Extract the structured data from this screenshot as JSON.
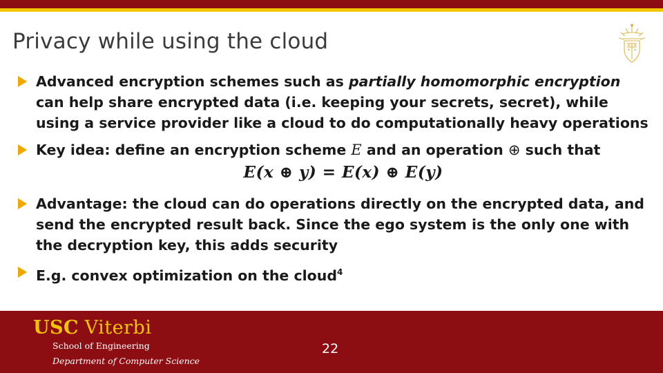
{
  "slide": {
    "title": "Privacy while using the cloud",
    "colors": {
      "maroon": "#8c0d12",
      "gold": "#f2c500",
      "bullet_arrow": "#f0a800",
      "title_text": "#3b3b3b",
      "body_text": "#1a1a1a"
    },
    "bullets": [
      {
        "id": "bullet-1",
        "segments": [
          {
            "text": "Advanced encryption schemes such as ",
            "style": "bold"
          },
          {
            "text": "partially homomorphic encryption",
            "style": "bold-italic"
          },
          {
            "text": " can help share encrypted data (i.e. keeping your secrets, secret), while using a service provider like a cloud to do computationally heavy operations",
            "style": "bold"
          }
        ]
      },
      {
        "id": "bullet-2",
        "segments": [
          {
            "text": "Key idea: define an encryption scheme ",
            "style": "bold"
          },
          {
            "text": "E",
            "style": "math"
          },
          {
            "text": " and an operation ",
            "style": "bold"
          },
          {
            "text": "⊕",
            "style": "math-op"
          },
          {
            "text": " such that",
            "style": "bold"
          }
        ],
        "equation": "E(x ⊕ y) = E(x) ⊕ E(y)"
      },
      {
        "id": "bullet-3",
        "segments": [
          {
            "text": "Advantage: the cloud can do operations directly on the encrypted data, and send the encrypted result back. Since the ego system is the only one with the decryption key, this adds security",
            "style": "bold"
          }
        ]
      },
      {
        "id": "bullet-4",
        "segments": [
          {
            "text": "E.g. convex optimization on the cloud",
            "style": "bold"
          },
          {
            "text": "4",
            "style": "superscript"
          }
        ]
      }
    ],
    "footer": {
      "usc": "USC",
      "viterbi": "Viterbi",
      "school": "School of Engineering",
      "department": "Department of Computer Science",
      "page_number": "22"
    }
  }
}
